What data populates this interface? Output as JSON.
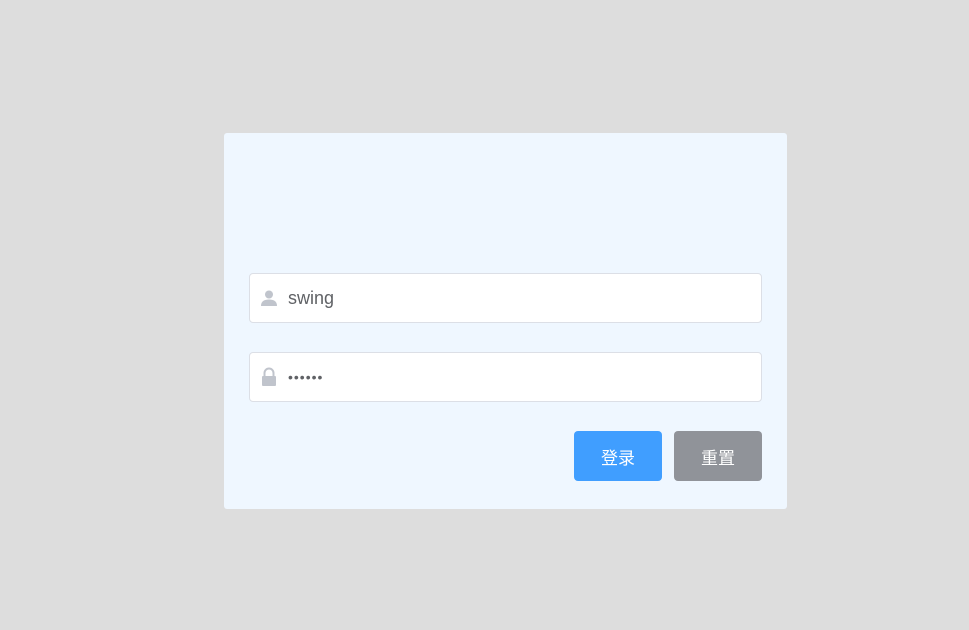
{
  "login_form": {
    "username": {
      "value": "swing",
      "icon": "user-icon"
    },
    "password": {
      "value": "123456",
      "icon": "lock-icon"
    },
    "buttons": {
      "login_label": "登录",
      "reset_label": "重置"
    }
  },
  "colors": {
    "background": "#dddddd",
    "card": "#eff7ff",
    "primary": "#409eff",
    "secondary": "#909399",
    "icon": "#c0c4cc"
  }
}
